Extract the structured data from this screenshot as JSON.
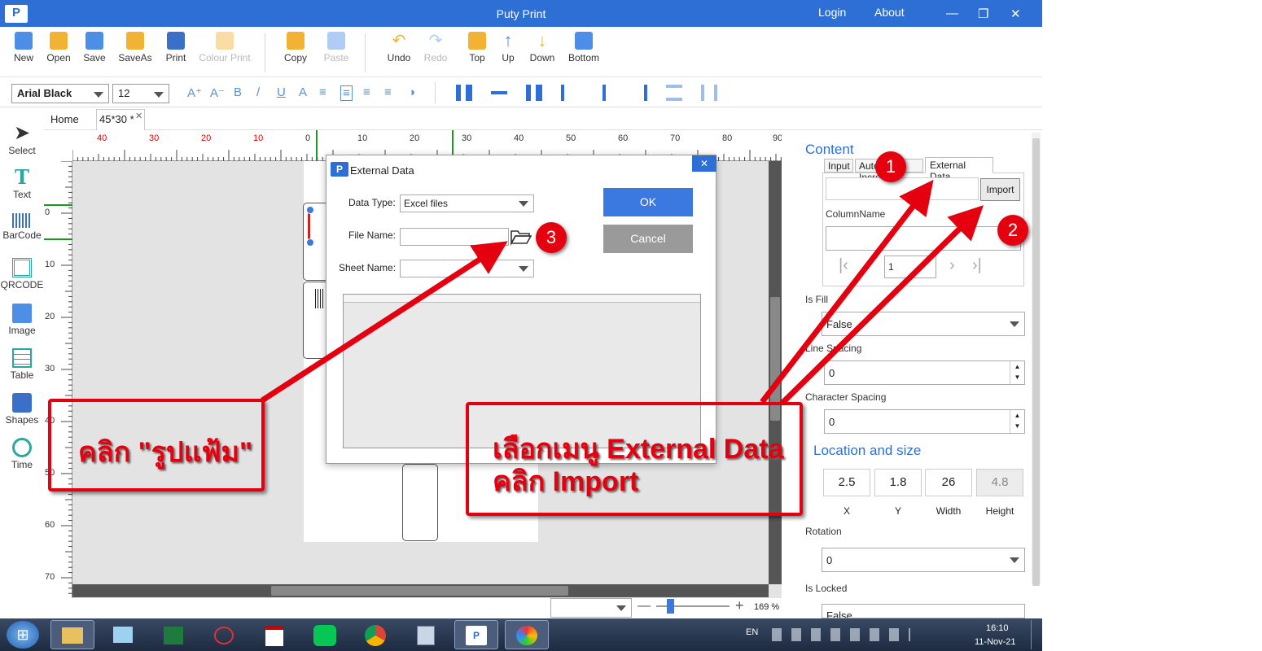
{
  "window": {
    "title": "Puty Print",
    "logo_text": "P",
    "login": "Login",
    "about": "About",
    "minimize": "—",
    "restore": "❐",
    "close": "✕"
  },
  "toolbar": {
    "new": "New",
    "open": "Open",
    "save": "Save",
    "saveas": "SaveAs",
    "print": "Print",
    "colour_print": "Colour Print",
    "copy": "Copy",
    "paste": "Paste",
    "undo": "Undo",
    "redo": "Redo",
    "top": "Top",
    "up": "Up",
    "down": "Down",
    "bottom": "Bottom"
  },
  "format": {
    "font": "Arial Black",
    "size": "12"
  },
  "tabs": {
    "home": "Home",
    "doc": "45*30 *",
    "doc_close": "✕"
  },
  "left_tools": {
    "select": "Select",
    "text": "Text",
    "barcode": "BarCode",
    "qrcode": "QRCODE",
    "image": "Image",
    "table": "Table",
    "shapes": "Shapes",
    "time": "Time"
  },
  "ruler": {
    "top": [
      "40",
      "30",
      "20",
      "10",
      "0",
      "10",
      "20",
      "30",
      "40",
      "50",
      "60",
      "70",
      "80",
      "90"
    ],
    "left": [
      "0",
      "10",
      "20",
      "30",
      "40",
      "50",
      "60",
      "70"
    ]
  },
  "zoom": {
    "value": "169 %"
  },
  "dialog": {
    "title": "External Data",
    "close": "✕",
    "data_type_label": "Data Type:",
    "data_type_value": "Excel files",
    "file_name_label": "File Name:",
    "file_name_value": "",
    "sheet_name_label": "Sheet Name:",
    "sheet_name_value": "",
    "ok": "OK",
    "cancel": "Cancel"
  },
  "panel": {
    "content_title": "Content",
    "tab_input": "Input",
    "tab_auto_increase": "Auto Increase",
    "tab_external": "External Data",
    "import": "Import",
    "column_name_label": "ColumnName",
    "page_value": "1",
    "is_fill_label": "Is Fill",
    "is_fill_value": "False",
    "line_spacing_label": "Line Spacing",
    "line_spacing_value": "0",
    "char_spacing_label": "Character Spacing",
    "char_spacing_value": "0",
    "location_title": "Location and size",
    "x": "2.5",
    "y": "1.8",
    "width": "26",
    "height": "4.8",
    "x_label": "X",
    "y_label": "Y",
    "width_label": "Width",
    "height_label": "Height",
    "rotation_label": "Rotation",
    "rotation_value": "0",
    "is_locked_label": "Is Locked",
    "is_locked_value": "False"
  },
  "annotations": {
    "left_text": "คลิก \"รูปแฟ้ม\"",
    "right_line1": "เลือกเมนู External Data",
    "right_line2": "คลิก Import",
    "badge1": "1",
    "badge2": "2",
    "badge3": "3"
  },
  "taskbar": {
    "lang": "EN",
    "time": "16:10",
    "date": "11-Nov-21",
    "start_label": "⊞"
  },
  "colors": {
    "accent": "#2d6fd4",
    "ok_button": "#3b78e0",
    "cancel_button": "#9a9a9a",
    "annotation": "#e4000f"
  }
}
